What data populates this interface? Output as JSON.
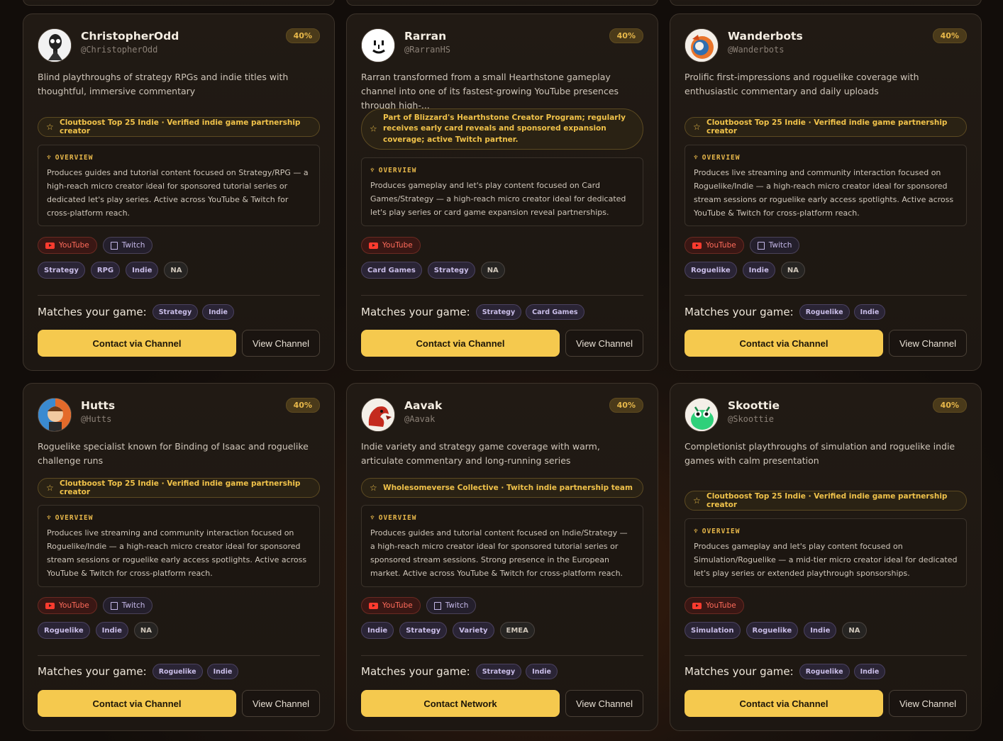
{
  "common": {
    "matches_label": "Matches your game:",
    "view_label": "View Channel",
    "overview_label": "OVERVIEW",
    "youtube_label": "YouTube",
    "twitch_label": "Twitch"
  },
  "cards": [
    {
      "name": "ChristopherOdd",
      "handle": "@ChristopherOdd",
      "percent": "40%",
      "description": "Blind playthroughs of strategy RPGs and indie titles with thoughtful, immersive commentary",
      "badge": "Cloutboost Top 25 Indie · Verified indie game partnership creator",
      "overview": "Produces guides and tutorial content focused on Strategy/RPG — a high-reach micro creator ideal for sponsored tutorial series or dedicated let's play series. Active across YouTube & Twitch for cross-platform reach.",
      "tags": [
        "Strategy",
        "RPG",
        "Indie",
        "NA"
      ],
      "matches": [
        "Strategy",
        "Indie"
      ],
      "cta": "Contact via Channel"
    },
    {
      "name": "Rarran",
      "handle": "@RarranHS",
      "percent": "40%",
      "description": "Rarran transformed from a small Hearthstone gameplay channel into one of its fastest-growing YouTube presences through high-...",
      "badge": "Part of Blizzard's Hearthstone Creator Program; regularly receives early card reveals and sponsored expansion coverage; active Twitch partner.",
      "overview": "Produces gameplay and let's play content focused on Card Games/Strategy — a high-reach micro creator ideal for dedicated let's play series or card game expansion reveal partnerships.",
      "tags": [
        "Card Games",
        "Strategy",
        "NA"
      ],
      "matches": [
        "Strategy",
        "Card Games"
      ],
      "cta": "Contact via Channel"
    },
    {
      "name": "Wanderbots",
      "handle": "@Wanderbots",
      "percent": "40%",
      "description": "Prolific first-impressions and roguelike coverage with enthusiastic commentary and daily uploads",
      "badge": "Cloutboost Top 25 Indie · Verified indie game partnership creator",
      "overview": "Produces live streaming and community interaction focused on Roguelike/Indie — a high-reach micro creator ideal for sponsored stream sessions or roguelike early access spotlights. Active across YouTube & Twitch for cross-platform reach.",
      "tags": [
        "Roguelike",
        "Indie",
        "NA"
      ],
      "matches": [
        "Roguelike",
        "Indie"
      ],
      "cta": "Contact via Channel"
    },
    {
      "name": "Hutts",
      "handle": "@Hutts",
      "percent": "40%",
      "description": "Roguelike specialist known for Binding of Isaac and roguelike challenge runs",
      "badge": "Cloutboost Top 25 Indie · Verified indie game partnership creator",
      "overview": "Produces live streaming and community interaction focused on Roguelike/Indie — a high-reach micro creator ideal for sponsored stream sessions or roguelike early access spotlights. Active across YouTube & Twitch for cross-platform reach.",
      "tags": [
        "Roguelike",
        "Indie",
        "NA"
      ],
      "matches": [
        "Roguelike",
        "Indie"
      ],
      "cta": "Contact via Channel"
    },
    {
      "name": "Aavak",
      "handle": "@Aavak",
      "percent": "40%",
      "description": "Indie variety and strategy game coverage with warm, articulate commentary and long-running series",
      "badge": "Wholesomeverse Collective · Twitch indie partnership team",
      "overview": "Produces guides and tutorial content focused on Indie/Strategy — a high-reach micro creator ideal for sponsored tutorial series or sponsored stream sessions. Strong presence in the European market. Active across YouTube & Twitch for cross-platform reach.",
      "tags": [
        "Indie",
        "Strategy",
        "Variety",
        "EMEA"
      ],
      "matches": [
        "Strategy",
        "Indie"
      ],
      "cta": "Contact Network"
    },
    {
      "name": "Skoottie",
      "handle": "@Skoottie",
      "percent": "40%",
      "description": "Completionist playthroughs of simulation and roguelike indie games with calm presentation",
      "badge": "Cloutboost Top 25 Indie · Verified indie game partnership creator",
      "overview": "Produces gameplay and let's play content focused on Simulation/Roguelike — a mid-tier micro creator ideal for dedicated let's play series or extended playthrough sponsorships.",
      "tags": [
        "Simulation",
        "Roguelike",
        "Indie",
        "NA"
      ],
      "matches": [
        "Roguelike",
        "Indie"
      ],
      "cta": "Contact via Channel"
    }
  ]
}
